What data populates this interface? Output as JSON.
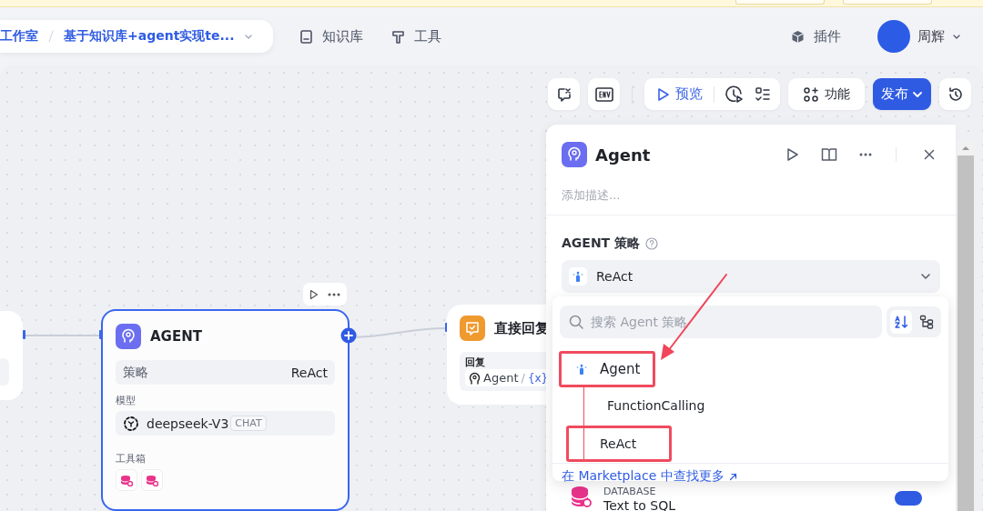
{
  "header": {
    "breadcrumb": [
      "工作室",
      "基于知识库+agent实现te..."
    ],
    "nav": [
      {
        "label": "知识库",
        "kind": "book"
      },
      {
        "label": "工具",
        "kind": "hammer"
      },
      {
        "label": "插件",
        "kind": "cube"
      }
    ],
    "user": {
      "name": "周辉"
    }
  },
  "toolbar": {
    "preview": "预览",
    "features": "功能",
    "publish": "发布"
  },
  "agent_node": {
    "title": "AGENT",
    "selected": true,
    "strategy_label": "策略",
    "strategy": "ReAct",
    "model_label": "模型",
    "model": "deepseek-V3",
    "model_tag": "CHAT",
    "tools_label": "工具箱"
  },
  "answer_node": {
    "title": "直接回复",
    "field_label": "回复",
    "ref_node": "Agent",
    "ref_sep": "/",
    "ref_var": "{x}"
  },
  "panel": {
    "title": "Agent",
    "description_placeholder": "添加描述...",
    "strategy_label": "AGENT 策略",
    "strategy": "ReAct",
    "tool": {
      "category": "DATABASE",
      "name": "Text to SQL",
      "enabled": true
    }
  },
  "dropdown": {
    "search_placeholder": "搜索 Agent 策略",
    "groups": [
      {
        "label": "Agent",
        "highlighted": true,
        "children": [
          {
            "label": "FunctionCalling",
            "highlighted": false
          },
          {
            "label": "ReAct",
            "highlighted": true
          }
        ]
      }
    ],
    "more_link": "在 Marketplace 中查找更多"
  }
}
